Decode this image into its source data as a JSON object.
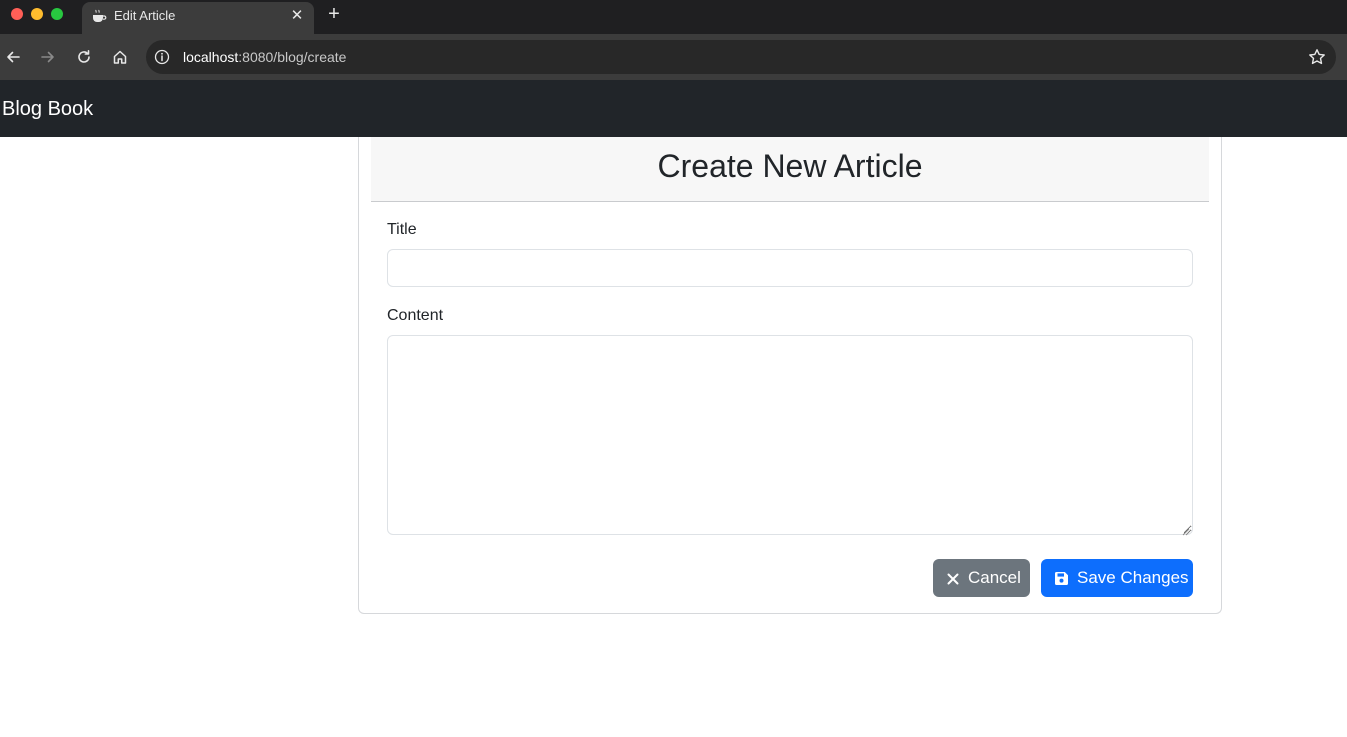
{
  "browser": {
    "tab_title": "Edit Article",
    "new_tab": "+",
    "close": "✕",
    "url_host": "localhost",
    "url_path": ":8080/blog/create"
  },
  "navbar": {
    "brand": "Blog Book"
  },
  "form": {
    "heading": "Create New Article",
    "title_label": "Title",
    "title_value": "",
    "content_label": "Content",
    "content_value": "",
    "cancel_label": "Cancel",
    "save_label": "Save Changes"
  },
  "colors": {
    "navbar_bg": "#212529",
    "cancel_bg": "#6c757d",
    "save_bg": "#0d6efd"
  }
}
